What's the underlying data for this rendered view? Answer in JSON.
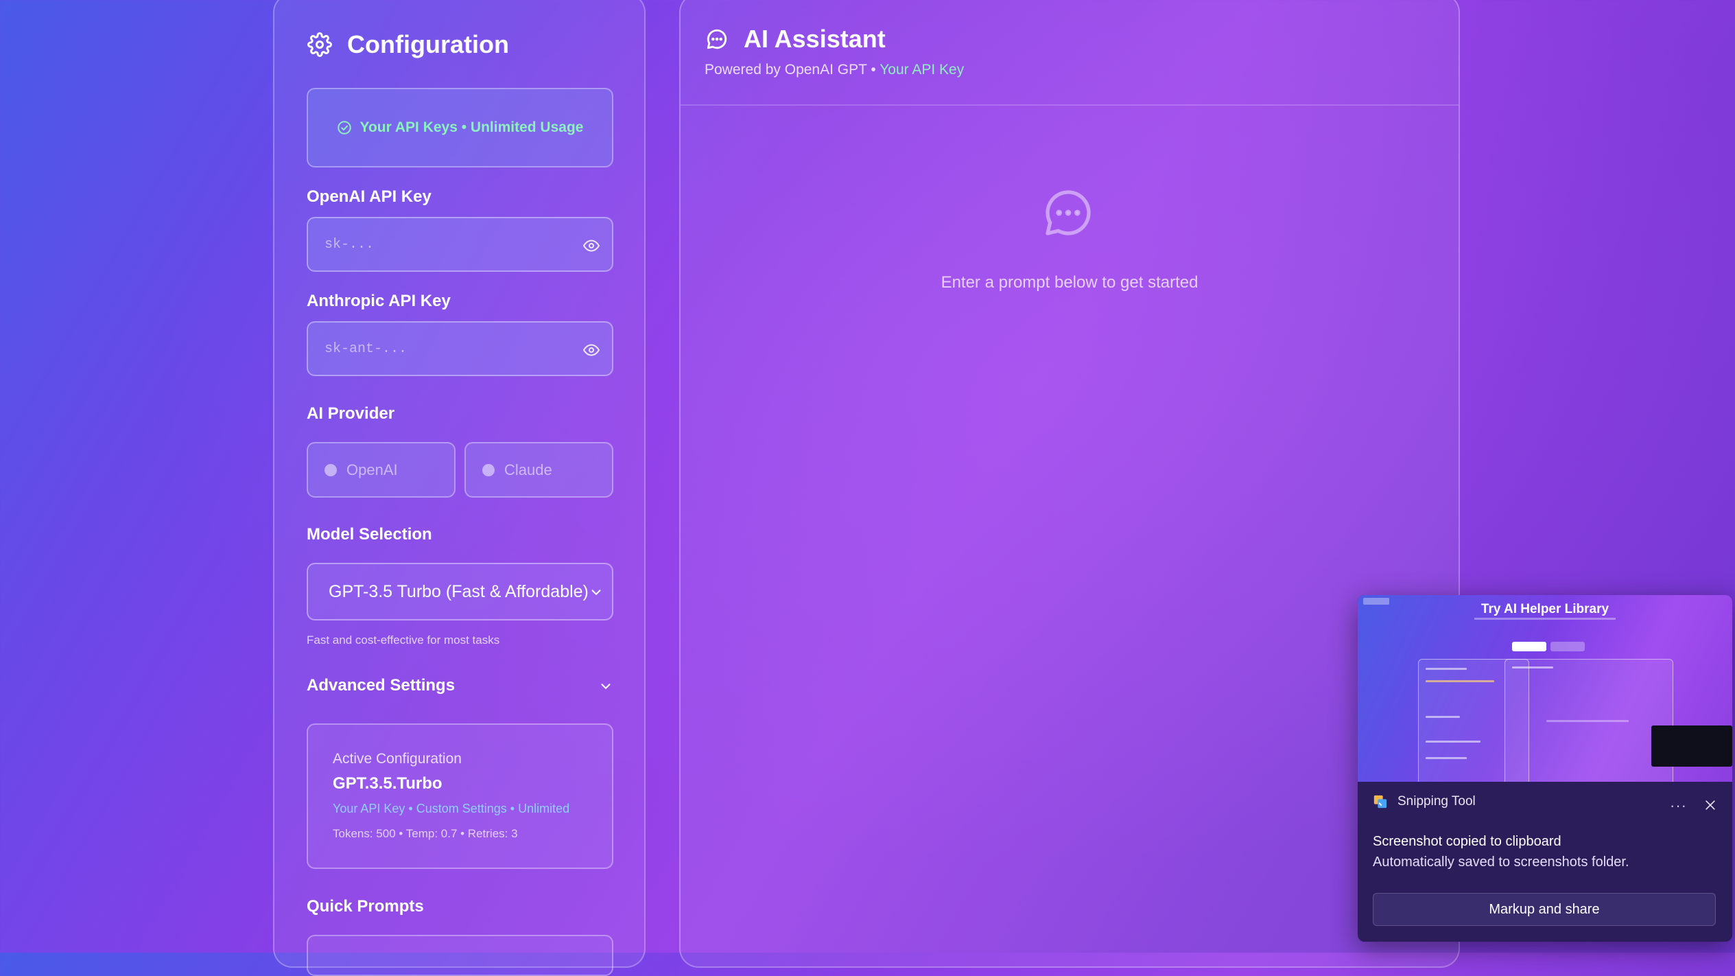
{
  "config": {
    "title": "Configuration",
    "status": "Your API Keys • Unlimited Usage",
    "openai_label": "OpenAI API Key",
    "openai_placeholder": "sk-...",
    "anthropic_label": "Anthropic API Key",
    "anthropic_placeholder": "sk-ant-...",
    "provider_label": "AI Provider",
    "providers": [
      "OpenAI",
      "Claude"
    ],
    "model_label": "Model Selection",
    "model_selected": "GPT-3.5 Turbo (Fast & Affordable)",
    "model_hint": "Fast and cost-effective for most tasks",
    "advanced_label": "Advanced Settings",
    "active": {
      "label": "Active Configuration",
      "model": "GPT.3.5.Turbo",
      "meta": "Your API Key • Custom Settings • Unlimited",
      "stats": "Tokens: 500 • Temp: 0.7 • Retries: 3"
    },
    "quick_prompts_label": "Quick Prompts"
  },
  "assistant": {
    "title": "AI Assistant",
    "subtitle_prefix": "Powered by OpenAI GPT • ",
    "subtitle_highlight": "Your API Key",
    "empty_text": "Enter a prompt below to get started"
  },
  "toast": {
    "app_name": "Snipping Tool",
    "more": "···",
    "message1": "Screenshot copied to clipboard",
    "message2": "Automatically saved to screenshots folder.",
    "action": "Markup and share",
    "preview_title": "Try AI Helper Library"
  },
  "colors": {
    "accent_green": "#8df0c0",
    "accent_blue": "#8fd0ff",
    "toast_bg": "#2a1d5a"
  }
}
